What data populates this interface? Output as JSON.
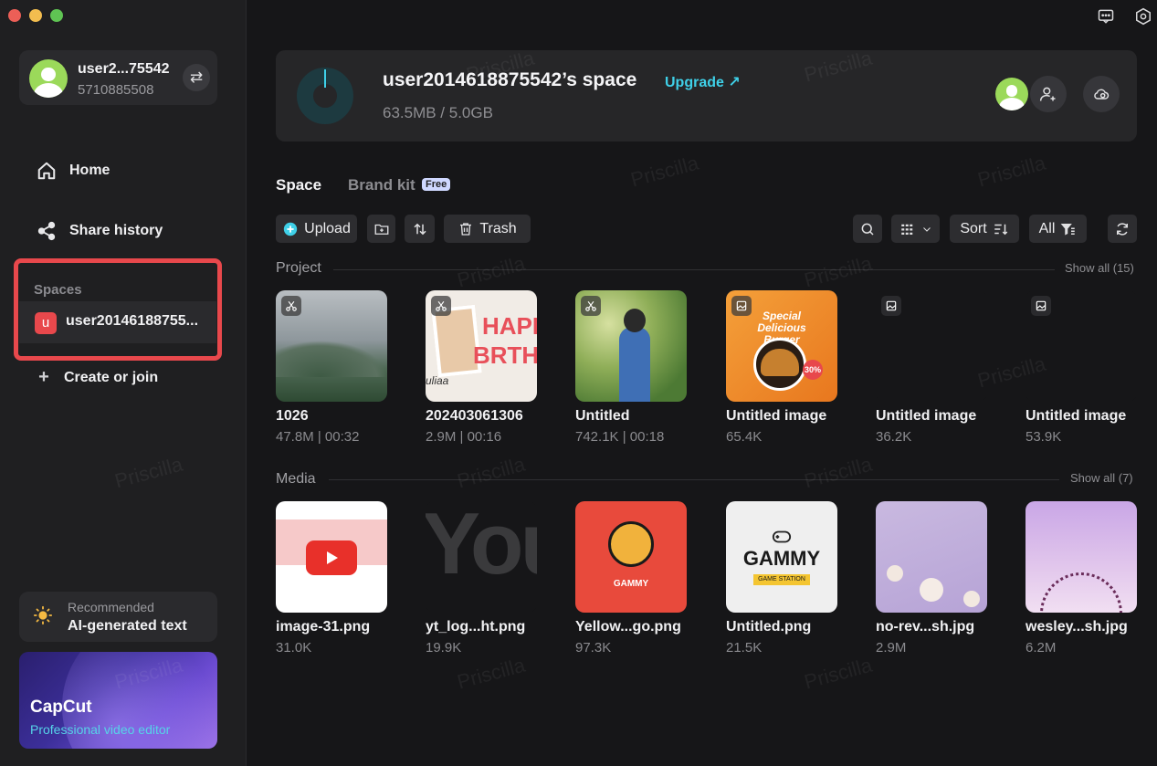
{
  "colors": {
    "accent": "#3fd0e8",
    "highlight_border": "#e8484c",
    "space_badge": "#e8484c"
  },
  "sidebar": {
    "account": {
      "name": "user2...75542",
      "id": "5710885508",
      "swap_icon": "swap-icon"
    },
    "nav": [
      {
        "label": "Home",
        "icon": "home-icon"
      },
      {
        "label": "Share history",
        "icon": "share-icon"
      }
    ],
    "spaces": {
      "label": "Spaces",
      "badge": "u",
      "name": "user20146188755..."
    },
    "create": {
      "label": "Create or join"
    },
    "recommended": {
      "label": "Recommended",
      "title": "AI-generated text"
    },
    "promo": {
      "title": "CapCut",
      "subtitle": "Professional video editor"
    }
  },
  "header": {
    "space_title": "user2014618875542’s space",
    "upgrade_label": "Upgrade ↗",
    "storage": "63.5MB / 5.0GB",
    "storage_fraction": 0.0127
  },
  "tabs": [
    {
      "label": "Space"
    },
    {
      "label": "Brand kit"
    }
  ],
  "brand_badge": "Free",
  "toolbar": {
    "upload": "Upload",
    "trash": "Trash",
    "sort": "Sort",
    "filter": "All"
  },
  "project": {
    "label": "Project",
    "show_all": "Show all (15)",
    "items": [
      {
        "name": "1026",
        "meta": "47.8M | 00:32"
      },
      {
        "name": "202403061306",
        "meta": "2.9M | 00:16"
      },
      {
        "name": "Untitled",
        "meta": "742.1K | 00:18"
      },
      {
        "name": "Untitled image",
        "meta": "65.4K"
      },
      {
        "name": "Untitled image",
        "meta": "36.2K"
      },
      {
        "name": "Untitled image",
        "meta": "53.9K"
      }
    ]
  },
  "media": {
    "label": "Media",
    "show_all": "Show all (7)",
    "items": [
      {
        "name": "image-31.png",
        "meta": "31.0K"
      },
      {
        "name": "yt_log...ht.png",
        "meta": "19.9K"
      },
      {
        "name": "Yellow...go.png",
        "meta": "97.3K"
      },
      {
        "name": "Untitled.png",
        "meta": "21.5K"
      },
      {
        "name": "no-rev...sh.jpg",
        "meta": "2.9M"
      },
      {
        "name": "wesley...sh.jpg",
        "meta": "6.2M"
      }
    ]
  },
  "thumb_text": {
    "happy": "HAPP",
    "birthday": "BRTH",
    "gammy_logo": "GAMMY",
    "gammy_sub": "GAME STATION",
    "yt_big": "You",
    "burger": "Special Delicious Burger",
    "burger_off": "30%",
    "signature": "uliaa"
  },
  "watermark": "Priscilla"
}
